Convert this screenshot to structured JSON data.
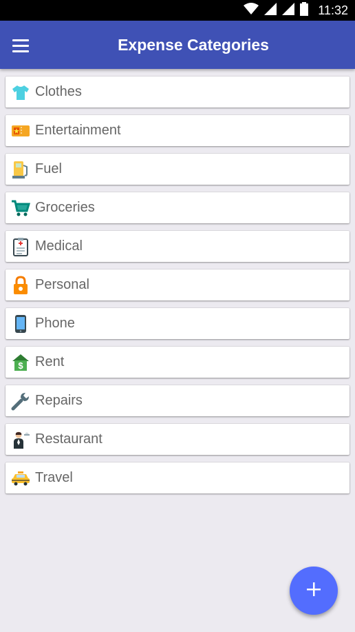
{
  "status_bar": {
    "time": "11:32"
  },
  "app_bar": {
    "title": "Expense Categories"
  },
  "categories": [
    {
      "label": "Clothes",
      "icon": "shirt-icon"
    },
    {
      "label": "Entertainment",
      "icon": "ticket-icon"
    },
    {
      "label": "Fuel",
      "icon": "fuel-pump-icon"
    },
    {
      "label": "Groceries",
      "icon": "shopping-cart-icon"
    },
    {
      "label": "Medical",
      "icon": "medical-clipboard-icon"
    },
    {
      "label": "Personal",
      "icon": "padlock-icon"
    },
    {
      "label": "Phone",
      "icon": "smartphone-icon"
    },
    {
      "label": "Rent",
      "icon": "house-dollar-icon"
    },
    {
      "label": "Repairs",
      "icon": "wrench-icon"
    },
    {
      "label": "Restaurant",
      "icon": "waiter-icon"
    },
    {
      "label": "Travel",
      "icon": "taxi-icon"
    }
  ],
  "colors": {
    "app_bar": "#3f51b5",
    "fab": "#536dfe",
    "background": "#eceaf0"
  }
}
